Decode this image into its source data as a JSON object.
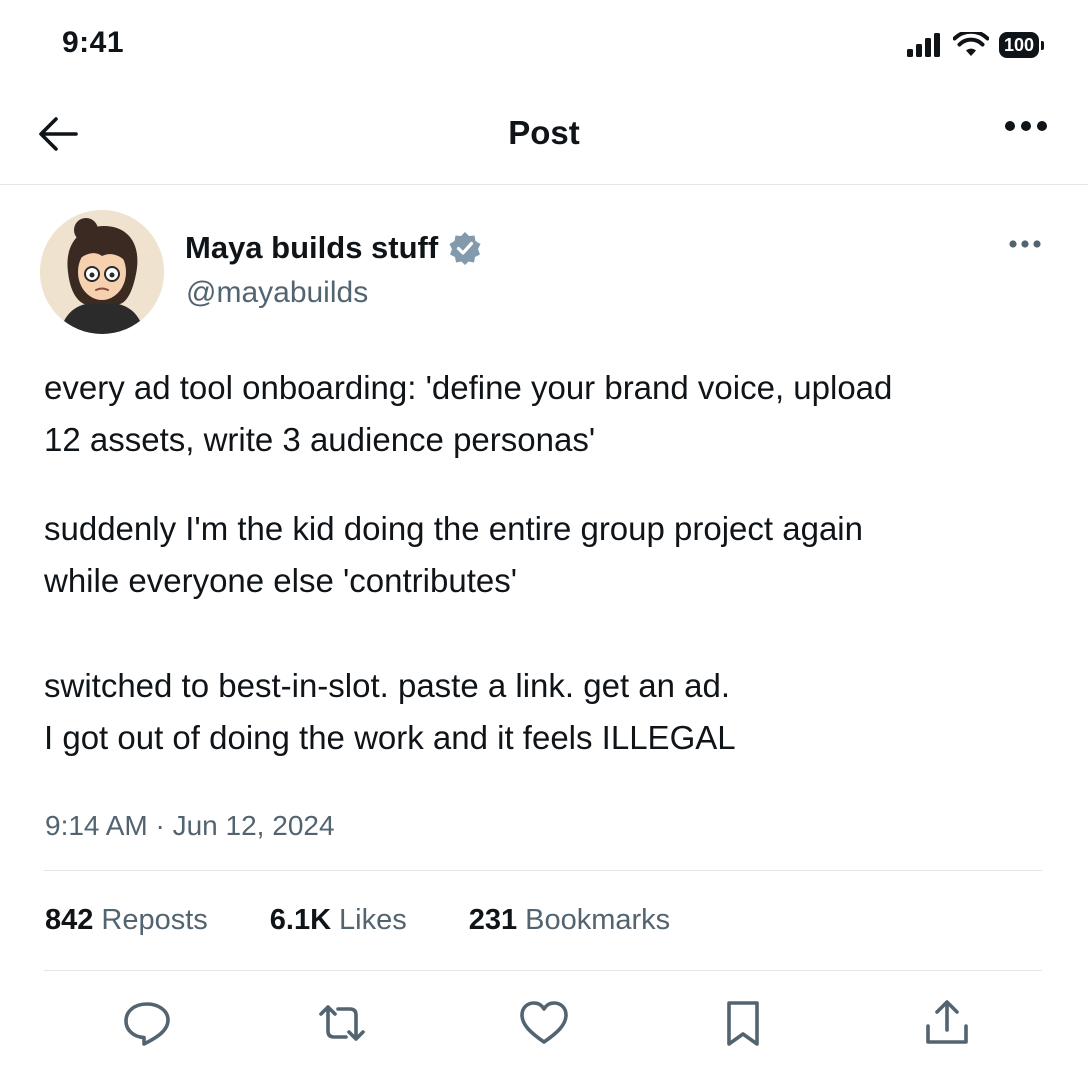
{
  "status_bar": {
    "time": "9:41",
    "battery": "100"
  },
  "header": {
    "title": "Post",
    "back_icon": "arrow-left-icon",
    "more_icon": "more-horizontal-icon"
  },
  "post": {
    "author": {
      "name": "Maya builds stuff",
      "handle": "@mayabuilds",
      "verified": true,
      "verified_color": "#829aab"
    },
    "paragraphs": [
      [
        "every ad tool onboarding: 'define your brand voice, upload",
        "12 assets, write 3 audience personas'"
      ],
      [
        "suddenly I'm the kid doing the entire group project again",
        "while everyone else 'contributes'"
      ],
      [
        "switched to best-in-slot. paste a link. get an ad.",
        "I got out of doing the work and it feels ILLEGAL"
      ]
    ],
    "timestamp": "9:14 AM · Jun 12, 2024",
    "stats": {
      "reposts_count": "842",
      "reposts_label": "Reposts",
      "likes_count": "6.1K",
      "likes_label": "Likes",
      "bookmarks_count": "231",
      "bookmarks_label": "Bookmarks"
    },
    "actions": [
      "reply-icon",
      "repost-icon",
      "like-icon",
      "bookmark-icon",
      "share-icon"
    ]
  },
  "colors": {
    "text_primary": "#0f1419",
    "text_secondary": "#536471",
    "divider": "#e3e6e9"
  }
}
